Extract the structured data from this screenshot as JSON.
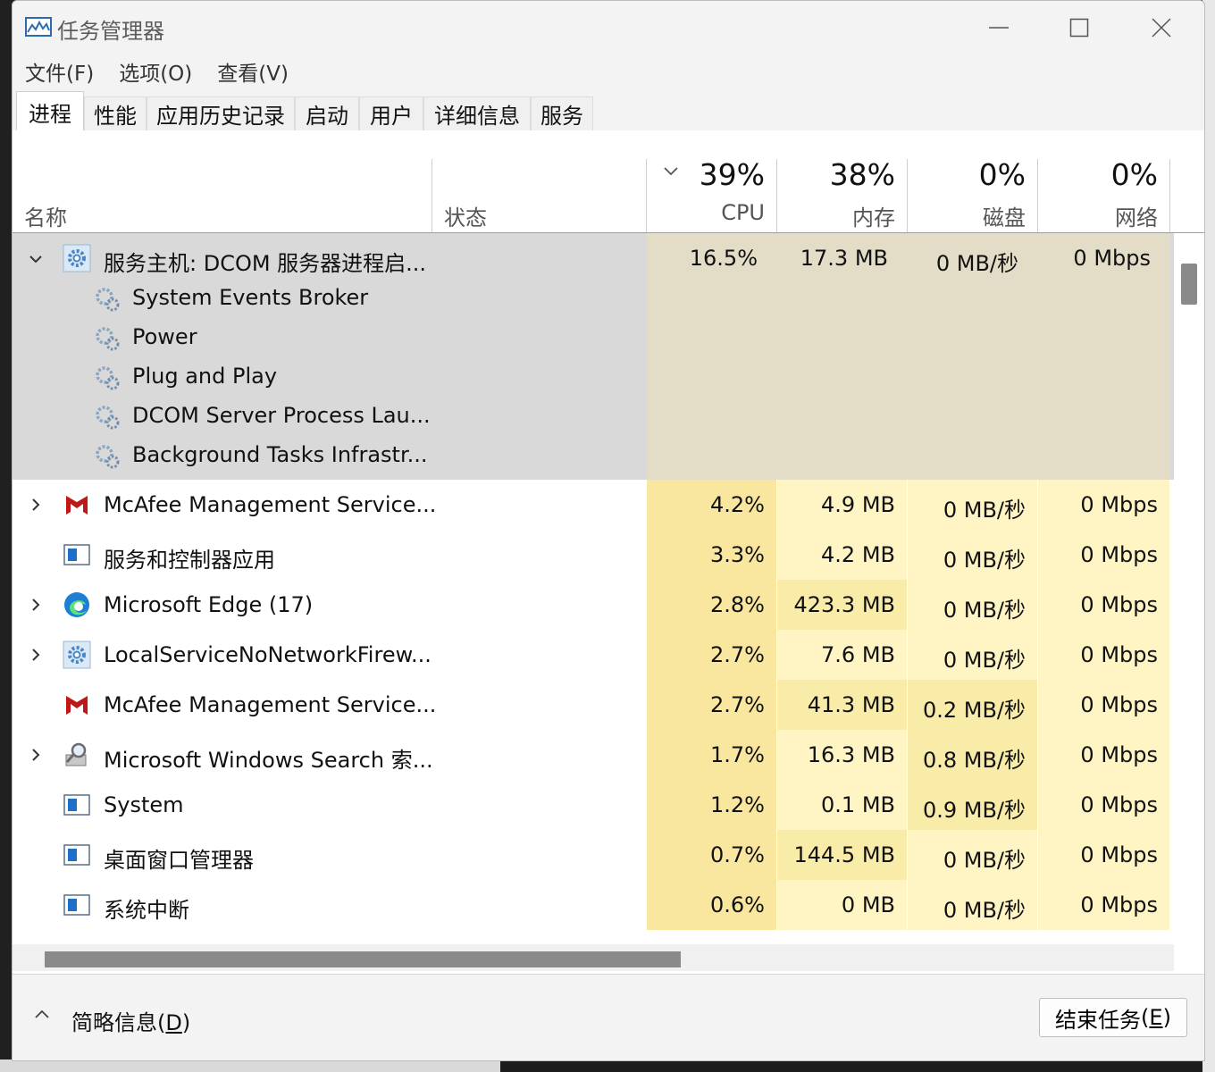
{
  "window": {
    "title": "任务管理器",
    "controls": {
      "minimize_icon": "minimize-icon",
      "maximize_icon": "maximize-icon",
      "close_icon": "close-icon"
    }
  },
  "menu": [
    "文件(F)",
    "选项(O)",
    "查看(V)"
  ],
  "tabs": [
    {
      "label": "进程",
      "active": true
    },
    {
      "label": "性能"
    },
    {
      "label": "应用历史记录"
    },
    {
      "label": "启动"
    },
    {
      "label": "用户"
    },
    {
      "label": "详细信息"
    },
    {
      "label": "服务"
    }
  ],
  "columns": {
    "name": "名称",
    "status": "状态",
    "cpu": {
      "pct": "39%",
      "label": "CPU"
    },
    "memory": {
      "pct": "38%",
      "label": "内存"
    },
    "disk": {
      "pct": "0%",
      "label": "磁盘"
    },
    "network": {
      "pct": "0%",
      "label": "网络"
    }
  },
  "expanded_group": {
    "name": "服务主机: DCOM 服务器进程启...",
    "cpu": "16.5%",
    "memory": "17.3 MB",
    "disk": "0 MB/秒",
    "network": "0 Mbps",
    "children": [
      "System Events Broker",
      "Power",
      "Plug and Play",
      "DCOM Server Process Lau...",
      "Background Tasks Infrastr..."
    ]
  },
  "processes": [
    {
      "name": "McAfee Management Service...",
      "icon": "mcafee-icon",
      "expandable": true,
      "cpu": "4.2%",
      "memory": "4.9 MB",
      "disk": "0 MB/秒",
      "network": "0 Mbps"
    },
    {
      "name": "服务和控制器应用",
      "icon": "window-icon",
      "expandable": false,
      "cpu": "3.3%",
      "memory": "4.2 MB",
      "disk": "0 MB/秒",
      "network": "0 Mbps"
    },
    {
      "name": "Microsoft Edge (17)",
      "icon": "edge-icon",
      "expandable": true,
      "cpu": "2.8%",
      "memory": "423.3 MB",
      "disk": "0 MB/秒",
      "network": "0 Mbps"
    },
    {
      "name": "LocalServiceNoNetworkFirew...",
      "icon": "gear-icon",
      "expandable": true,
      "cpu": "2.7%",
      "memory": "7.6 MB",
      "disk": "0 MB/秒",
      "network": "0 Mbps"
    },
    {
      "name": "McAfee Management Service...",
      "icon": "mcafee-icon",
      "expandable": false,
      "cpu": "2.7%",
      "memory": "41.3 MB",
      "disk": "0.2 MB/秒",
      "network": "0 Mbps"
    },
    {
      "name": "Microsoft Windows Search 索...",
      "icon": "search-indexer-icon",
      "expandable": true,
      "cpu": "1.7%",
      "memory": "16.3 MB",
      "disk": "0.8 MB/秒",
      "network": "0 Mbps"
    },
    {
      "name": "System",
      "icon": "window-icon",
      "expandable": false,
      "cpu": "1.2%",
      "memory": "0.1 MB",
      "disk": "0.9 MB/秒",
      "network": "0 Mbps"
    },
    {
      "name": "桌面窗口管理器",
      "icon": "window-icon",
      "expandable": false,
      "cpu": "0.7%",
      "memory": "144.5 MB",
      "disk": "0 MB/秒",
      "network": "0 Mbps"
    },
    {
      "name": "系统中断",
      "icon": "window-icon",
      "expandable": false,
      "cpu": "0.6%",
      "memory": "0 MB",
      "disk": "0 MB/秒",
      "network": "0 Mbps"
    }
  ],
  "colors": {
    "heat_low": "#fff4c4",
    "heat_mid": "#f9eca8",
    "heat_high": "#f9e79f",
    "group_bg": "#d9d9d9",
    "group_heat": "#e3ddc7",
    "mcafee_red": "#c01818",
    "edge_blue": "#1b7fd6"
  },
  "footer": {
    "fewer_details_text": "简略信息",
    "fewer_details_key": "D",
    "end_task_text": "结束任务",
    "end_task_key": "E"
  }
}
